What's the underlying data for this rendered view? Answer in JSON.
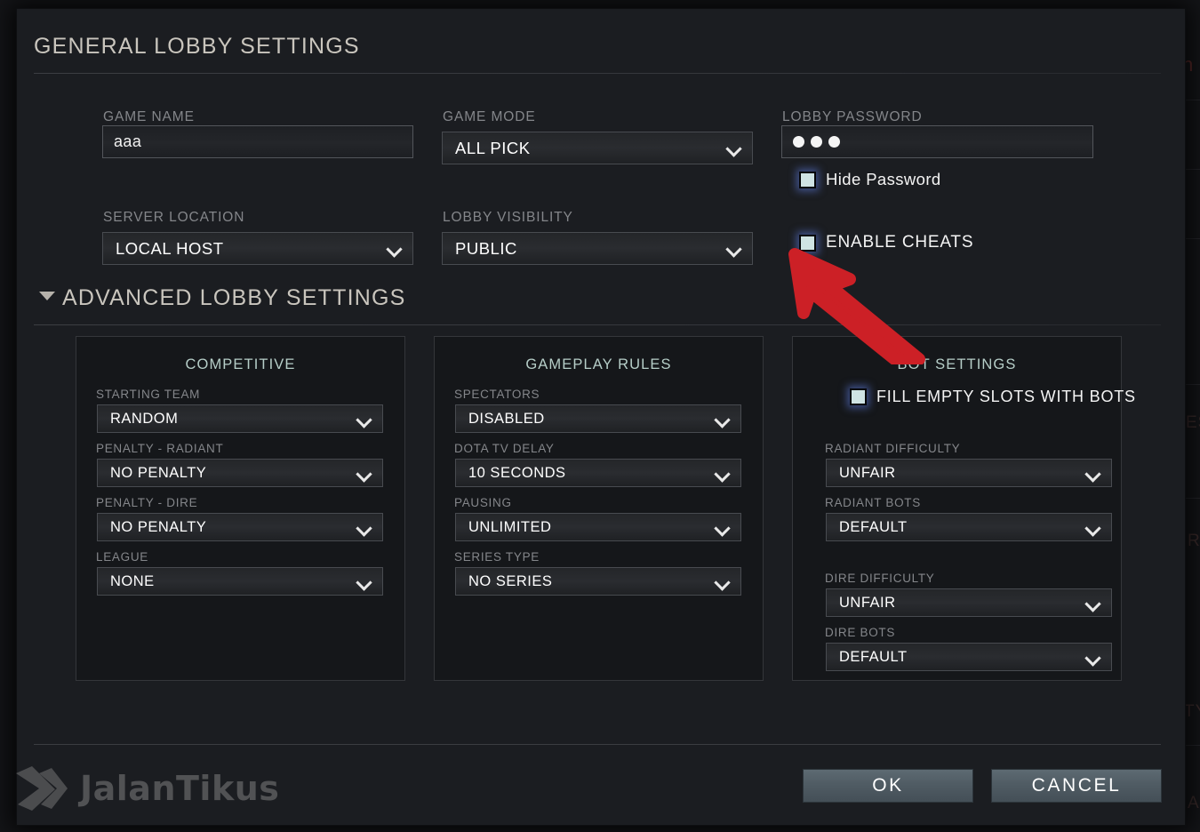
{
  "dialog": {
    "general_header": "GENERAL LOBBY SETTINGS",
    "advanced_header": "ADVANCED LOBBY SETTINGS"
  },
  "general": {
    "game_name": {
      "label": "GAME NAME",
      "value": "aaa"
    },
    "game_mode": {
      "label": "GAME MODE",
      "value": "ALL PICK"
    },
    "lobby_password": {
      "label": "LOBBY PASSWORD",
      "value": "●●●",
      "dots": 3
    },
    "hide_password": {
      "label": "Hide Password",
      "checked": true
    },
    "server_location": {
      "label": "SERVER LOCATION",
      "value": "LOCAL HOST"
    },
    "lobby_visibility": {
      "label": "LOBBY VISIBILITY",
      "value": "PUBLIC"
    },
    "enable_cheats": {
      "label": "ENABLE CHEATS",
      "checked": true
    }
  },
  "competitive": {
    "title": "COMPETITIVE",
    "fields": [
      {
        "label": "STARTING TEAM",
        "value": "RANDOM"
      },
      {
        "label": "PENALTY - RADIANT",
        "value": "NO PENALTY"
      },
      {
        "label": "PENALTY - DIRE",
        "value": "NO PENALTY"
      },
      {
        "label": "LEAGUE",
        "value": "NONE"
      }
    ]
  },
  "gameplay_rules": {
    "title": "GAMEPLAY RULES",
    "fields": [
      {
        "label": "SPECTATORS",
        "value": "DISABLED"
      },
      {
        "label": "DOTA TV DELAY",
        "value": "10 SECONDS"
      },
      {
        "label": "PAUSING",
        "value": "UNLIMITED"
      },
      {
        "label": "SERIES TYPE",
        "value": "NO SERIES"
      }
    ]
  },
  "bot_settings": {
    "title": "BOT SETTINGS",
    "fill_empty_slots": {
      "label": "FILL EMPTY SLOTS WITH BOTS",
      "checked": true
    },
    "fields": [
      {
        "label": "RADIANT DIFFICULTY",
        "value": "UNFAIR"
      },
      {
        "label": "RADIANT BOTS",
        "value": "DEFAULT"
      },
      {
        "label": "DIRE DIFFICULTY",
        "value": "UNFAIR"
      },
      {
        "label": "DIRE BOTS",
        "value": "DEFAULT"
      }
    ]
  },
  "footer": {
    "ok_label": "OK",
    "cancel_label": "CANCEL"
  },
  "watermark": {
    "text": "JalanTikus"
  },
  "annotation": {
    "type": "red-arrow",
    "color": "#cc2026",
    "points_to": "ENABLE CHEATS"
  },
  "colors": {
    "dialog_bg": "#1b1d21",
    "panel_bg": "#15171a",
    "panel_title": "#b6cec8",
    "label": "#84868a",
    "value": "#ffffff",
    "header": "#c9c5bd",
    "button": "#505c64",
    "checkbox_fill": "#cfe3e3",
    "annotation_red": "#cc2026"
  },
  "backdrop": {
    "fragments": [
      "h",
      "ES",
      "R",
      "TY",
      "A"
    ]
  }
}
